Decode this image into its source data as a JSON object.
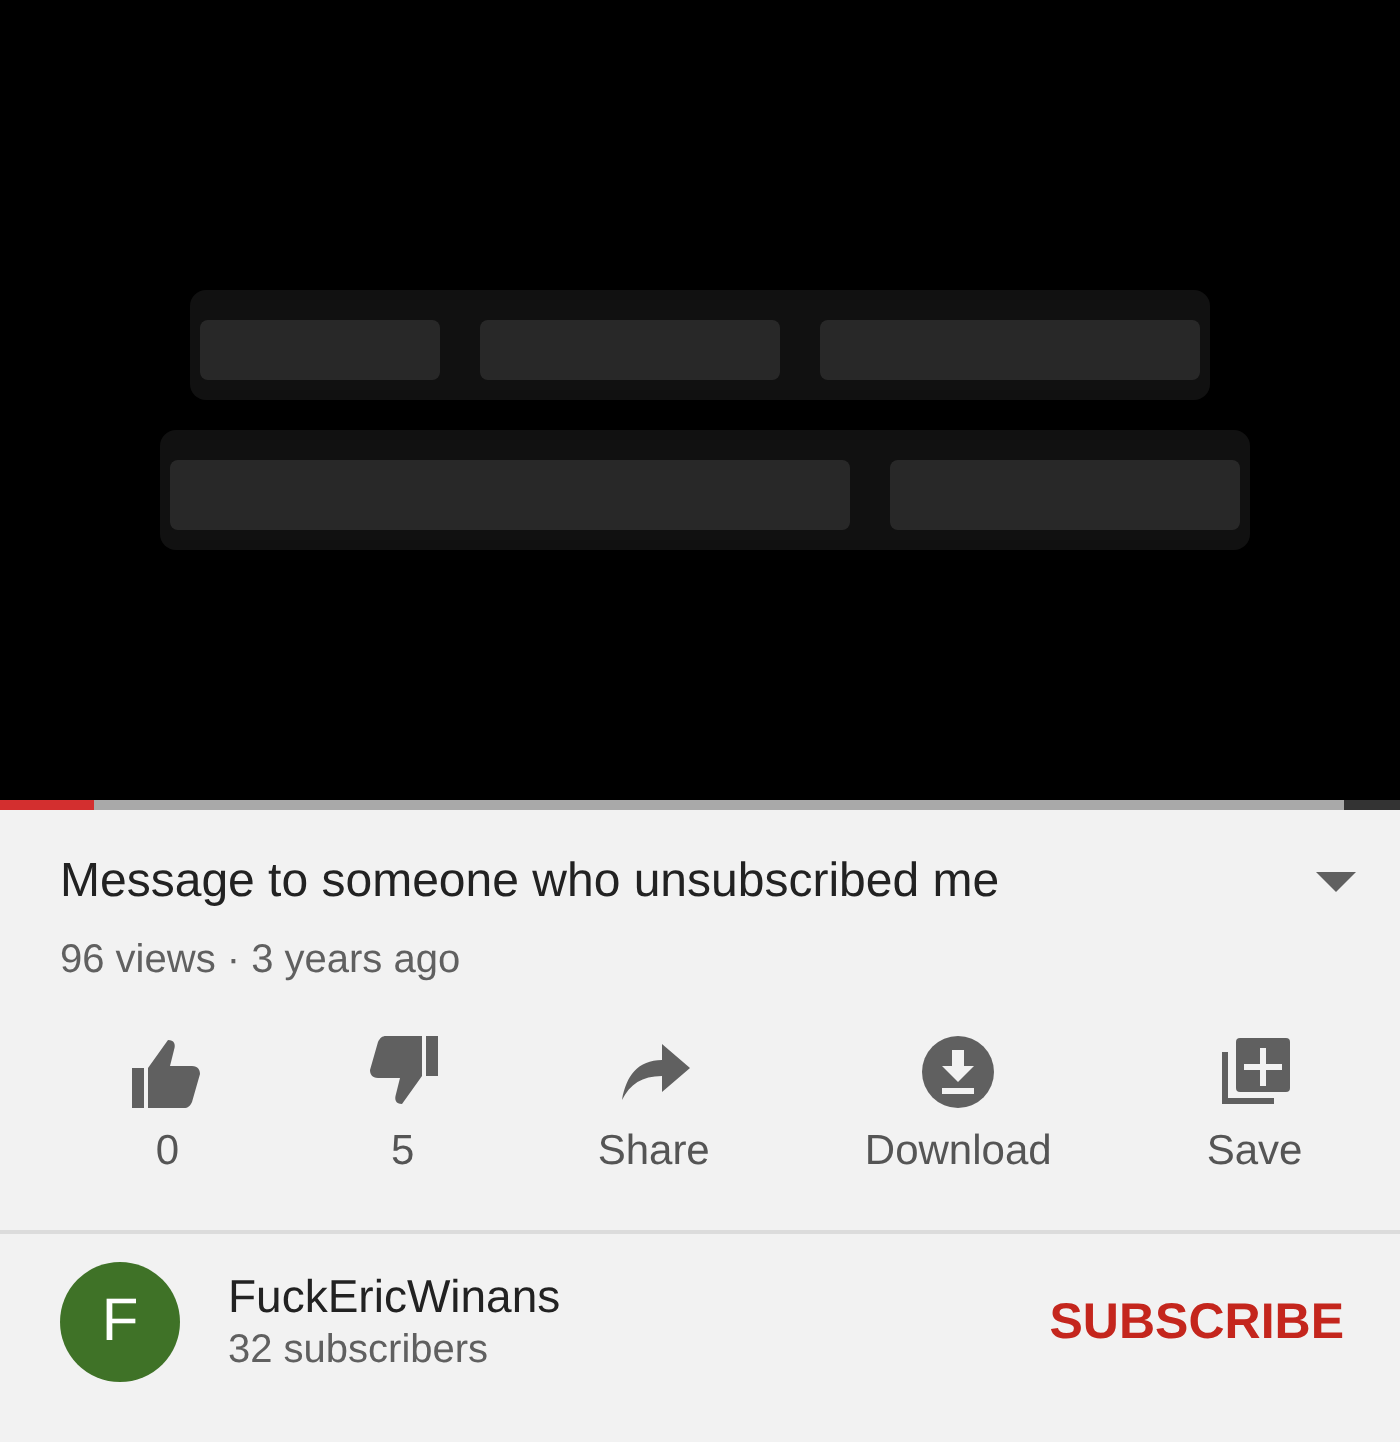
{
  "video": {
    "kind": "picture",
    "progress": {
      "level": 0.07
    }
  },
  "title": "Message to someone who unsubscribed me",
  "expand_button": {
    "expanded": false
  },
  "meta": "96 views · 3 years ago",
  "actions": [
    {
      "kind": "like",
      "label": "0"
    },
    {
      "kind": "dislike",
      "label": "5"
    },
    {
      "kind": "share",
      "label": "Share"
    },
    {
      "kind": "download",
      "label": "Download"
    },
    {
      "kind": "save",
      "label": "Save"
    }
  ],
  "channel": {
    "avatar_letter": "F",
    "name": "FuckEricWinans",
    "subscribers": "32 subscribers"
  },
  "subscribe_button": "SUBSCRIBE"
}
